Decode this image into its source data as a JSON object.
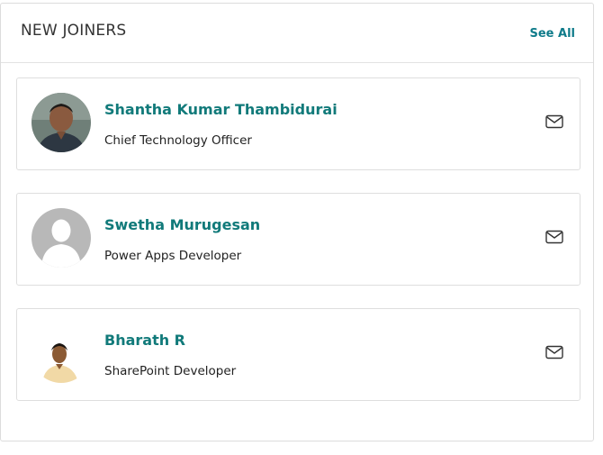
{
  "widget": {
    "title": "NEW JOINERS",
    "see_all_label": "See All"
  },
  "joiners": [
    {
      "name": "Shantha Kumar Thambidurai",
      "role": "Chief Technology Officer",
      "avatar": "photo-avatar",
      "action_icon": "mail-icon"
    },
    {
      "name": "Swetha Murugesan",
      "role": "Power Apps Developer",
      "avatar": "default-user-avatar",
      "action_icon": "mail-icon"
    },
    {
      "name": "Bharath R",
      "role": "SharePoint Developer",
      "avatar": "photo-avatar",
      "action_icon": "mail-icon"
    }
  ],
  "colors": {
    "accent": "#117a7a",
    "link": "#0f7b8a",
    "border": "#dedede",
    "placeholder_avatar": "#b8b8b8"
  }
}
